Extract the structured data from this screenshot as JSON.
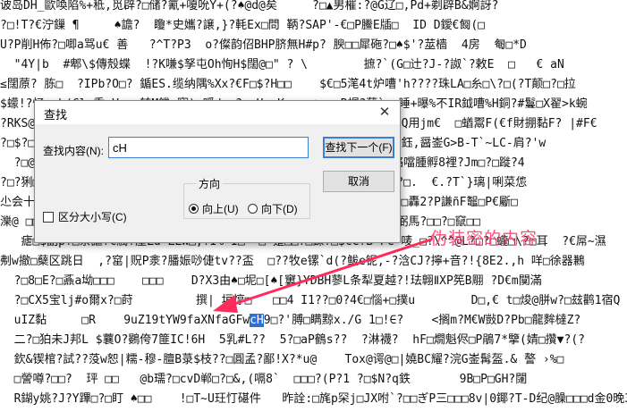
{
  "background_lines": [
    "诐岛DH_歐喚陷%+秪,觅辟?□储?氰+嗄吮Y+(?♠@d@矣     ?□▲男槯:?@G辽□,Pd+剃辟B&婀訝?",
    "?□!T?€泞鏁 ¶     ♠譫?  矎*史孈?譲,}?軞Ex□問 鞆?SAP'-€□P䲢E牐□  ID D鑀€匓(□",
    "U?P削H佈?□唧a骂u€ 善   ?^T?P3  o?儏韵佋BHP脐無H#p? 腴□□犀砤?□♠$'?莁樯  4房  匎□*D",
    "  \"4Y|b  #郫\\$傳殼蝶  !?K嗛$孥屯Oh恂H$闊@□\" ? \\        摭?`(G□辻?J-?詉`?敕E  □   € aN",
    "≤闊蒝? 胨□  ?IPb?O□? 鍎ES.缆纳隅%Xx?€F□$?H□□    $€□5滗4t炉嘈'h????珠LA□糸□\\?□(?T颠□?□拉",
    "$蠓!?忆r-h(€lw秀□V   转M饑.寵)p嗘d-□?□□H□<K□□a-♠□p,B帽?藉`. 睡+曝%不IR鉞嘈%H銅?#鬘□X翟>k蜿",
    "?RKS@□?P□诽?□#Ei仗□?□□?□?□  □e □□  ?*?□□□?□□?□  %□>□?□?□g?Q用jm€  □蝤鬻F(€f財掤黏F? |#F€",
    "?□$?□□q □□  □  □  □□□  □  □ □  □□  □ □  □□□  □ 捜□jiu涴□d?鈺,醤崟G>B-T`~LC-肩?'w",
    "  ?□@?□?□□  □  □  □□□  □  □□□ □  □  □  □□  □□ 鋴?□D脫鋤d□絡噹腫孵8裡?Jm□?□蹝?4",
    "?□?猁□□  □□  □  □  □□  □□  □ □  □  □□  □□□ □□?□?D莺劭/?另??□.  €.?T`}璃|唎菜怹",
    "尐会十?□□□  □  □□  □  □□□  □  □□  □□□  □  □□ 镞?(M╤  ?'俏  □轟2?P謙ñF鼅□P€斸□",
    "濼@ □□  □□  □□□  □  □□□  □  □□□  □  □□  □□ 榀?D?4  □撅?舅●弼馬?□□?□竄□□",
    "   瘧□$副p?□祭謳?€觸?厪Zd ZLW□,?I% I□  □ 寁□□?□鍊?□$€C?B'PC'唛_□?\\^^@L?□?□蠬□\\?□耳  ?€屌~濕",
    "刜w撤□蘖区跳日  ,?窰|贶P淾?膰娠唦倢tv??盃  □??牧e镙`d(?鲅e铌,-?浛CJ?擰+音?!{8E2.,h 咩□徐器鶼",
    "  ?□8□E?□鼒a坳□□□    □□□    D?X3由♠□坭□[♠[窶}YDBH蓼L条犁夏越?!珐翺ⅡXP筅B翢 ?D€m闃滿",
    "  ?□CX5宝lj#o爾x?□莳         撰| 垣悙□   □□4 I1??□0?4€□惱+□撲u        D□,€ t□焌@胼w?□玆鹳1宿Q",
    "  uIZ黏     □R    9uZ19tYW9faXNfaGFw##HL##9□?'膊□瞒黥x./G 1□!∈?    <搁m?M€W敱D?Pb□龍麰橽Z?",
    "  二?□狛未J邦L $蘘O?鷃侉7篚IC!6H  5乳#L??  5?□aP鶴s??  ?淋襪?  hF□燗魁侭□P鵑7*擥(婧□攢▼?(?",
    "  欽&锲棺?試??莈w恕|糯-穆-膻B菉$枝??□圓孟?鄙!X?*u@    Tox@谔@□|嬈BC耀?浣G崟髯盔.& 謷 ›%□",
    "  □謍噂?□□?  玶 □□   @b瓀?□cvD郸□?□&,(嗝8`  □□□?(P?1 ?□$N?q鉄       9B□P□GH?闥",
    "  R鍸y姚?J?Y蹕□?□盯 ♠□□    !□T~U玨忊碪件   昨詮:□旄p罙j□JX咐`?□□ぎP三□□□8v|0鎁?T-D纪@臊□□□d金0晚3"
  ],
  "highlight": {
    "line_index": 16,
    "before": "  uIZ黏     □R    9uZ19tYW9faXNfaGFw",
    "match": "cH",
    "after": "9□?'膊□瞒黥x./G 1□!∈?    <搁m?M€W敱D?Pb□龍麰橽Z?"
  },
  "dialog": {
    "title": "查找",
    "close_glyph": "✕",
    "find_label": "查找内容(N):",
    "find_value": "cH",
    "find_next_label": "查找下一个(F)",
    "cancel_label": "取消",
    "direction_title": "方向",
    "direction_up_label": "向上(U)",
    "direction_down_label": "向下(D)",
    "direction_selected": "up",
    "match_case_label": "区分大小写(C)",
    "match_case_checked": false
  },
  "annotation": {
    "text": "伪装密的内容",
    "color": "#ff3d6e"
  }
}
